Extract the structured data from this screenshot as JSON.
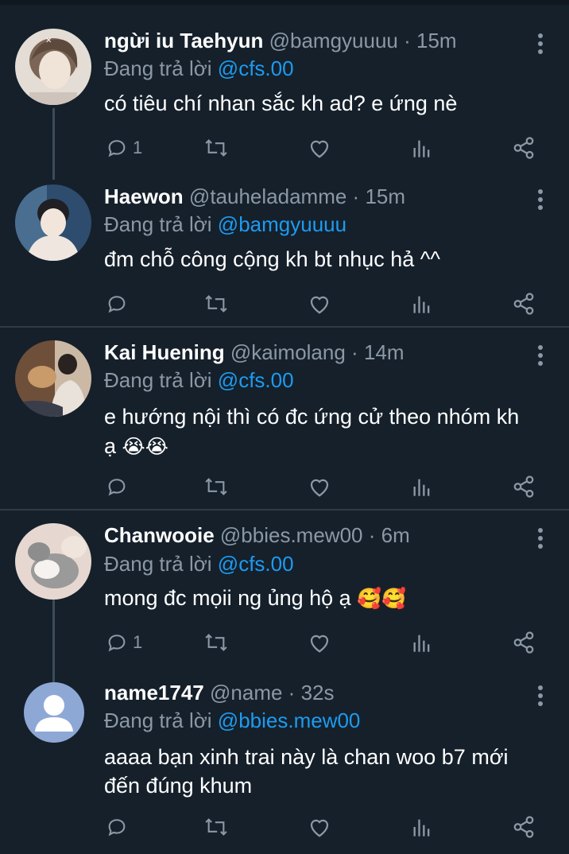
{
  "reply_prefix": "Đang trả lời",
  "tweets": [
    {
      "name": "ngừi iu Taehyun",
      "handle": "@bamgyuuuu",
      "separator": "·",
      "time": "15m",
      "reply_to": "@cfs.00",
      "text_lines": [
        "có tiêu chí nhan sắc kh ad? e ứng nè"
      ],
      "emoji": "",
      "reply_count": "1",
      "avatar": "photo-portrait",
      "colors": {
        "bg": "#d9d0c8",
        "fg": "#6b5a4f"
      }
    },
    {
      "name": "Haewon",
      "handle": "@tauheladamme",
      "separator": "·",
      "time": "15m",
      "reply_to": "@bamgyuuuu",
      "text_lines": [
        "đm chỗ công cộng kh bt nhục hả ^^"
      ],
      "emoji": "",
      "reply_count": "",
      "avatar": "photo-portrait",
      "colors": {
        "bg": "#3a5a7a",
        "fg": "#e8dcd0"
      }
    },
    {
      "name": "Kai Huening",
      "handle": "@kaimolang",
      "separator": "·",
      "time": "14m",
      "reply_to": "@cfs.00",
      "text_lines": [
        "e hướng nội thì có đc ứng cử theo nhóm kh",
        "ạ"
      ],
      "emoji": "😭😭",
      "reply_count": "",
      "avatar": "photo-portrait",
      "colors": {
        "bg": "#7a5a44",
        "fg": "#d8c8b8"
      }
    },
    {
      "name": "Chanwooie",
      "handle": "@bbies.mew00",
      "separator": "·",
      "time": "6m",
      "reply_to": "@cfs.00",
      "text_lines": [
        "mong đc mọii ng ủng hộ ạ"
      ],
      "emoji": "🥰🥰",
      "reply_count": "1",
      "avatar": "photo-cat",
      "colors": {
        "bg": "#e2d4cc",
        "fg": "#8a8a8a"
      }
    },
    {
      "name": "name1747",
      "handle": "@name",
      "separator": "·",
      "time": "32s",
      "reply_to": "@bbies.mew00",
      "text_lines": [
        "aaaa bạn xinh trai này là chan woo b7 mới",
        "đến đúng khum"
      ],
      "emoji": "",
      "reply_count": "",
      "avatar": "default-user-icon",
      "colors": {
        "bg": "#8ea8d6",
        "fg": "#ffffff"
      }
    }
  ],
  "accent_color": "#1d9bf0",
  "icons": [
    "reply-icon",
    "retweet-icon",
    "like-icon",
    "analytics-icon",
    "share-icon",
    "more-icon"
  ]
}
